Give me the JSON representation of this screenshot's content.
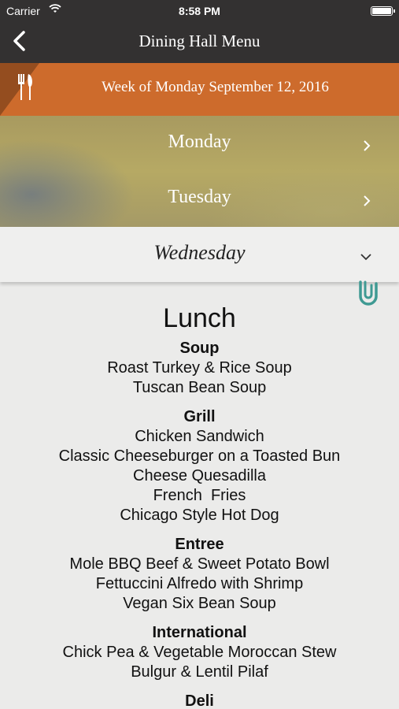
{
  "status_bar": {
    "carrier": "Carrier",
    "time": "8:58 PM"
  },
  "nav": {
    "title": "Dining Hall Menu",
    "back_icon": "chevron-left-icon"
  },
  "week": {
    "label": "Week of Monday September 12, 2016",
    "icon": "fork-knife-icon"
  },
  "days": [
    {
      "label": "Monday"
    },
    {
      "label": "Tuesday"
    }
  ],
  "selected_day": {
    "label": "Wednesday"
  },
  "menu": {
    "meal": "Lunch",
    "sections": [
      {
        "category": "Soup",
        "items": [
          "Roast Turkey & Rice Soup",
          "Tuscan Bean Soup"
        ]
      },
      {
        "category": "Grill",
        "items": [
          "Chicken Sandwich",
          "Classic Cheeseburger on a Toasted Bun",
          "Cheese Quesadilla",
          "French  Fries",
          "Chicago Style Hot Dog"
        ]
      },
      {
        "category": "Entree",
        "items": [
          "Mole BBQ Beef & Sweet Potato Bowl",
          "Fettuccini Alfredo with Shrimp",
          "Vegan Six Bean Soup"
        ]
      },
      {
        "category": "International",
        "items": [
          "Chick Pea & Vegetable Moroccan Stew",
          "Bulgur & Lentil Pilaf"
        ]
      },
      {
        "category": "Deli",
        "items": []
      }
    ]
  },
  "colors": {
    "nav_bg": "#333131",
    "week_bar": "#cd6b2c",
    "paperclip": "#3f9a93"
  }
}
